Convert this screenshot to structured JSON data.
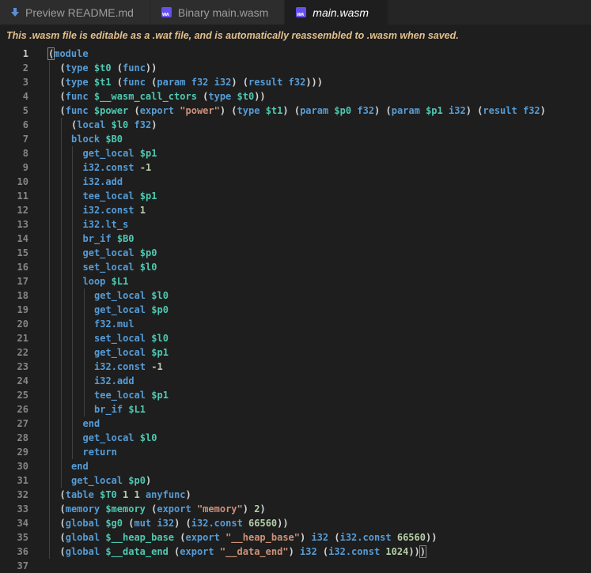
{
  "tabs": [
    {
      "label": "Preview README.md",
      "icon": "download-arrow-icon",
      "active": false
    },
    {
      "label": "Binary main.wasm",
      "icon": "wasm-icon",
      "active": false
    },
    {
      "label": "main.wasm",
      "icon": "wasm-icon",
      "active": true
    }
  ],
  "notice": "This .wasm file is editable as a .wat file, and is automatically reassembled to .wasm when saved.",
  "colors": {
    "keyword": "#569cd6",
    "variable": "#4ec9b0",
    "string": "#ce9178",
    "number": "#b5cea8",
    "notice": "#e2c08d",
    "background": "#1e1e1e"
  },
  "editor": {
    "current_line": 1,
    "lines": [
      {
        "n": "1",
        "indent": 0,
        "tokens": [
          [
            "p",
            "("
          ],
          [
            "k",
            "module"
          ]
        ]
      },
      {
        "n": "2",
        "indent": 1,
        "tokens": [
          [
            "p",
            "("
          ],
          [
            "k",
            "type"
          ],
          [
            "p",
            " "
          ],
          [
            "v",
            "$t0"
          ],
          [
            "p",
            " ("
          ],
          [
            "k",
            "func"
          ],
          [
            "p",
            "))"
          ]
        ]
      },
      {
        "n": "3",
        "indent": 1,
        "tokens": [
          [
            "p",
            "("
          ],
          [
            "k",
            "type"
          ],
          [
            "p",
            " "
          ],
          [
            "v",
            "$t1"
          ],
          [
            "p",
            " ("
          ],
          [
            "k",
            "func"
          ],
          [
            "p",
            " ("
          ],
          [
            "k",
            "param"
          ],
          [
            "p",
            " "
          ],
          [
            "k",
            "f32"
          ],
          [
            "p",
            " "
          ],
          [
            "k",
            "i32"
          ],
          [
            "p",
            ") ("
          ],
          [
            "k",
            "result"
          ],
          [
            "p",
            " "
          ],
          [
            "k",
            "f32"
          ],
          [
            "p",
            ")))"
          ]
        ]
      },
      {
        "n": "4",
        "indent": 1,
        "tokens": [
          [
            "p",
            "("
          ],
          [
            "k",
            "func"
          ],
          [
            "p",
            " "
          ],
          [
            "v",
            "$__wasm_call_ctors"
          ],
          [
            "p",
            " ("
          ],
          [
            "k",
            "type"
          ],
          [
            "p",
            " "
          ],
          [
            "v",
            "$t0"
          ],
          [
            "p",
            "))"
          ]
        ]
      },
      {
        "n": "5",
        "indent": 1,
        "tokens": [
          [
            "p",
            "("
          ],
          [
            "k",
            "func"
          ],
          [
            "p",
            " "
          ],
          [
            "v",
            "$power"
          ],
          [
            "p",
            " ("
          ],
          [
            "k",
            "export"
          ],
          [
            "p",
            " "
          ],
          [
            "s",
            "\"power\""
          ],
          [
            "p",
            ") ("
          ],
          [
            "k",
            "type"
          ],
          [
            "p",
            " "
          ],
          [
            "v",
            "$t1"
          ],
          [
            "p",
            ") ("
          ],
          [
            "k",
            "param"
          ],
          [
            "p",
            " "
          ],
          [
            "v",
            "$p0"
          ],
          [
            "p",
            " "
          ],
          [
            "k",
            "f32"
          ],
          [
            "p",
            ") ("
          ],
          [
            "k",
            "param"
          ],
          [
            "p",
            " "
          ],
          [
            "v",
            "$p1"
          ],
          [
            "p",
            " "
          ],
          [
            "k",
            "i32"
          ],
          [
            "p",
            ") ("
          ],
          [
            "k",
            "result"
          ],
          [
            "p",
            " "
          ],
          [
            "k",
            "f32"
          ],
          [
            "p",
            ")"
          ]
        ]
      },
      {
        "n": "6",
        "indent": 2,
        "tokens": [
          [
            "p",
            "("
          ],
          [
            "k",
            "local"
          ],
          [
            "p",
            " "
          ],
          [
            "v",
            "$l0"
          ],
          [
            "p",
            " "
          ],
          [
            "k",
            "f32"
          ],
          [
            "p",
            ")"
          ]
        ]
      },
      {
        "n": "7",
        "indent": 2,
        "tokens": [
          [
            "k",
            "block"
          ],
          [
            "p",
            " "
          ],
          [
            "v",
            "$B0"
          ]
        ]
      },
      {
        "n": "8",
        "indent": 3,
        "tokens": [
          [
            "k",
            "get_local"
          ],
          [
            "p",
            " "
          ],
          [
            "v",
            "$p1"
          ]
        ]
      },
      {
        "n": "9",
        "indent": 3,
        "tokens": [
          [
            "k",
            "i32.const"
          ],
          [
            "p",
            " "
          ],
          [
            "n",
            "-1"
          ]
        ]
      },
      {
        "n": "10",
        "indent": 3,
        "tokens": [
          [
            "k",
            "i32.add"
          ]
        ]
      },
      {
        "n": "11",
        "indent": 3,
        "tokens": [
          [
            "k",
            "tee_local"
          ],
          [
            "p",
            " "
          ],
          [
            "v",
            "$p1"
          ]
        ]
      },
      {
        "n": "12",
        "indent": 3,
        "tokens": [
          [
            "k",
            "i32.const"
          ],
          [
            "p",
            " "
          ],
          [
            "n",
            "1"
          ]
        ]
      },
      {
        "n": "13",
        "indent": 3,
        "tokens": [
          [
            "k",
            "i32.lt_s"
          ]
        ]
      },
      {
        "n": "14",
        "indent": 3,
        "tokens": [
          [
            "k",
            "br_if"
          ],
          [
            "p",
            " "
          ],
          [
            "v",
            "$B0"
          ]
        ]
      },
      {
        "n": "15",
        "indent": 3,
        "tokens": [
          [
            "k",
            "get_local"
          ],
          [
            "p",
            " "
          ],
          [
            "v",
            "$p0"
          ]
        ]
      },
      {
        "n": "16",
        "indent": 3,
        "tokens": [
          [
            "k",
            "set_local"
          ],
          [
            "p",
            " "
          ],
          [
            "v",
            "$l0"
          ]
        ]
      },
      {
        "n": "17",
        "indent": 3,
        "tokens": [
          [
            "k",
            "loop"
          ],
          [
            "p",
            " "
          ],
          [
            "v",
            "$L1"
          ]
        ]
      },
      {
        "n": "18",
        "indent": 4,
        "tokens": [
          [
            "k",
            "get_local"
          ],
          [
            "p",
            " "
          ],
          [
            "v",
            "$l0"
          ]
        ]
      },
      {
        "n": "19",
        "indent": 4,
        "tokens": [
          [
            "k",
            "get_local"
          ],
          [
            "p",
            " "
          ],
          [
            "v",
            "$p0"
          ]
        ]
      },
      {
        "n": "20",
        "indent": 4,
        "tokens": [
          [
            "k",
            "f32.mul"
          ]
        ]
      },
      {
        "n": "21",
        "indent": 4,
        "tokens": [
          [
            "k",
            "set_local"
          ],
          [
            "p",
            " "
          ],
          [
            "v",
            "$l0"
          ]
        ]
      },
      {
        "n": "22",
        "indent": 4,
        "tokens": [
          [
            "k",
            "get_local"
          ],
          [
            "p",
            " "
          ],
          [
            "v",
            "$p1"
          ]
        ]
      },
      {
        "n": "23",
        "indent": 4,
        "tokens": [
          [
            "k",
            "i32.const"
          ],
          [
            "p",
            " "
          ],
          [
            "n",
            "-1"
          ]
        ]
      },
      {
        "n": "24",
        "indent": 4,
        "tokens": [
          [
            "k",
            "i32.add"
          ]
        ]
      },
      {
        "n": "25",
        "indent": 4,
        "tokens": [
          [
            "k",
            "tee_local"
          ],
          [
            "p",
            " "
          ],
          [
            "v",
            "$p1"
          ]
        ]
      },
      {
        "n": "26",
        "indent": 4,
        "tokens": [
          [
            "k",
            "br_if"
          ],
          [
            "p",
            " "
          ],
          [
            "v",
            "$L1"
          ]
        ]
      },
      {
        "n": "27",
        "indent": 3,
        "tokens": [
          [
            "k",
            "end"
          ]
        ]
      },
      {
        "n": "28",
        "indent": 3,
        "tokens": [
          [
            "k",
            "get_local"
          ],
          [
            "p",
            " "
          ],
          [
            "v",
            "$l0"
          ]
        ]
      },
      {
        "n": "29",
        "indent": 3,
        "tokens": [
          [
            "k",
            "return"
          ]
        ]
      },
      {
        "n": "30",
        "indent": 2,
        "tokens": [
          [
            "k",
            "end"
          ]
        ]
      },
      {
        "n": "31",
        "indent": 2,
        "tokens": [
          [
            "k",
            "get_local"
          ],
          [
            "p",
            " "
          ],
          [
            "v",
            "$p0"
          ],
          [
            "p",
            ")"
          ]
        ]
      },
      {
        "n": "32",
        "indent": 1,
        "tokens": [
          [
            "p",
            "("
          ],
          [
            "k",
            "table"
          ],
          [
            "p",
            " "
          ],
          [
            "v",
            "$T0"
          ],
          [
            "p",
            " "
          ],
          [
            "n",
            "1"
          ],
          [
            "p",
            " "
          ],
          [
            "n",
            "1"
          ],
          [
            "p",
            " "
          ],
          [
            "k",
            "anyfunc"
          ],
          [
            "p",
            ")"
          ]
        ]
      },
      {
        "n": "33",
        "indent": 1,
        "tokens": [
          [
            "p",
            "("
          ],
          [
            "k",
            "memory"
          ],
          [
            "p",
            " "
          ],
          [
            "v",
            "$memory"
          ],
          [
            "p",
            " ("
          ],
          [
            "k",
            "export"
          ],
          [
            "p",
            " "
          ],
          [
            "s",
            "\"memory\""
          ],
          [
            "p",
            ") "
          ],
          [
            "n",
            "2"
          ],
          [
            "p",
            ")"
          ]
        ]
      },
      {
        "n": "34",
        "indent": 1,
        "tokens": [
          [
            "p",
            "("
          ],
          [
            "k",
            "global"
          ],
          [
            "p",
            " "
          ],
          [
            "v",
            "$g0"
          ],
          [
            "p",
            " ("
          ],
          [
            "k",
            "mut"
          ],
          [
            "p",
            " "
          ],
          [
            "k",
            "i32"
          ],
          [
            "p",
            ") ("
          ],
          [
            "k",
            "i32.const"
          ],
          [
            "p",
            " "
          ],
          [
            "n",
            "66560"
          ],
          [
            "p",
            "))"
          ]
        ]
      },
      {
        "n": "35",
        "indent": 1,
        "tokens": [
          [
            "p",
            "("
          ],
          [
            "k",
            "global"
          ],
          [
            "p",
            " "
          ],
          [
            "v",
            "$__heap_base"
          ],
          [
            "p",
            " ("
          ],
          [
            "k",
            "export"
          ],
          [
            "p",
            " "
          ],
          [
            "s",
            "\"__heap_base\""
          ],
          [
            "p",
            ") "
          ],
          [
            "k",
            "i32"
          ],
          [
            "p",
            " ("
          ],
          [
            "k",
            "i32.const"
          ],
          [
            "p",
            " "
          ],
          [
            "n",
            "66560"
          ],
          [
            "p",
            "))"
          ]
        ]
      },
      {
        "n": "36",
        "indent": 1,
        "tokens": [
          [
            "p",
            "("
          ],
          [
            "k",
            "global"
          ],
          [
            "p",
            " "
          ],
          [
            "v",
            "$__data_end"
          ],
          [
            "p",
            " ("
          ],
          [
            "k",
            "export"
          ],
          [
            "p",
            " "
          ],
          [
            "s",
            "\"__data_end\""
          ],
          [
            "p",
            ") "
          ],
          [
            "k",
            "i32"
          ],
          [
            "p",
            " ("
          ],
          [
            "k",
            "i32.const"
          ],
          [
            "p",
            " "
          ],
          [
            "n",
            "1024"
          ],
          [
            "p",
            "))"
          ],
          [
            "p",
            ")"
          ]
        ]
      },
      {
        "n": "37",
        "indent": 0,
        "tokens": []
      }
    ]
  }
}
